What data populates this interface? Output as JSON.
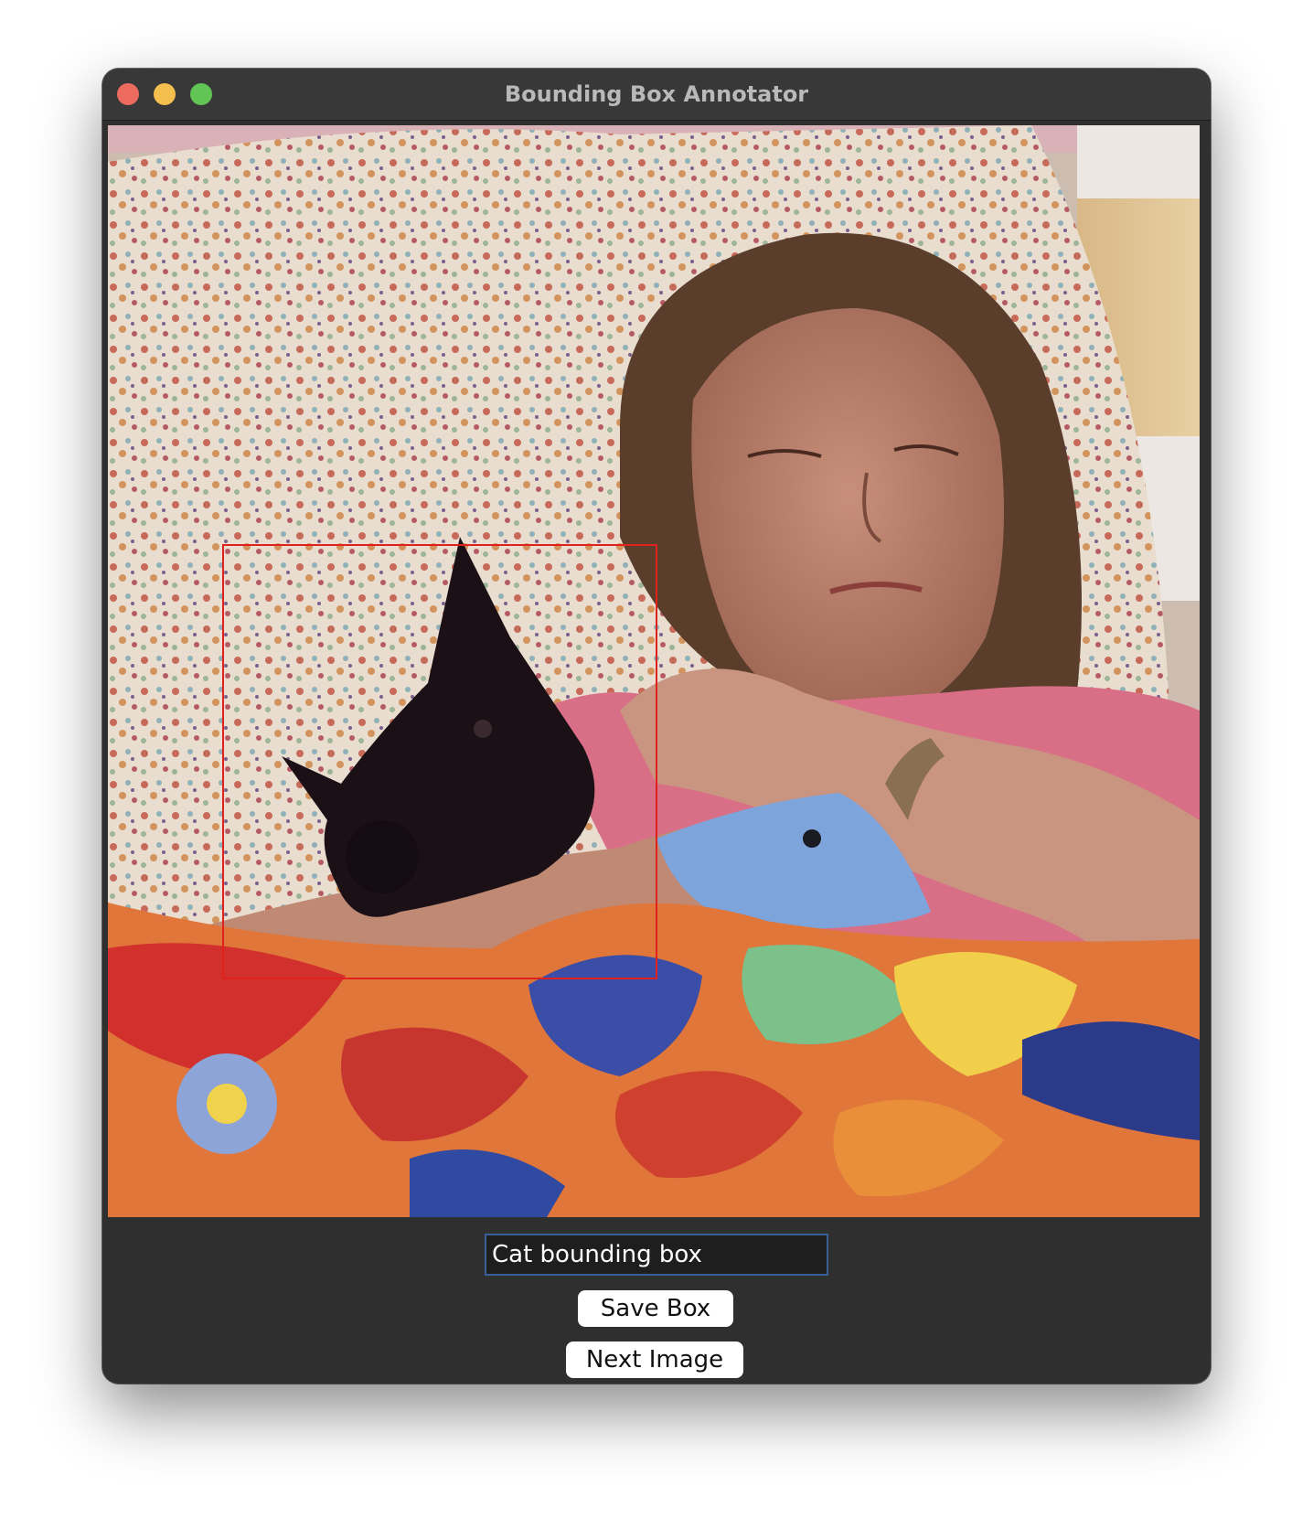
{
  "window": {
    "title": "Bounding Box Annotator"
  },
  "canvas": {
    "image_description": "photo",
    "bbox_color": "#e0221e"
  },
  "controls": {
    "label_value": "Cat bounding box",
    "save_label": "Save Box",
    "next_label": "Next Image"
  },
  "colors": {
    "window_bg": "#2f2f2f",
    "titlebar_bg": "#383838",
    "close": "#ed6a5e",
    "minimize": "#f5bf4f",
    "maximize": "#61c454",
    "input_border": "#3a5f98"
  }
}
